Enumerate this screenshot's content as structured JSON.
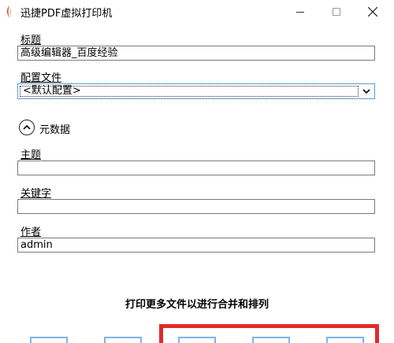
{
  "window": {
    "title": "迅捷PDF虚拟打印机",
    "controls": [
      "minimize",
      "maximize",
      "close"
    ]
  },
  "fields": {
    "title_label": "标题",
    "title_value": "高级编辑器_百度经验",
    "config_label": "配置文件",
    "config_value": "<默认配置>",
    "metadata_label": "元数据",
    "subject_label": "主题",
    "subject_value": "",
    "keywords_label": "关键字",
    "keywords_value": "",
    "author_label": "作者",
    "author_value": "admin"
  },
  "merge": {
    "text": "打印更多文件以进行合并和排列"
  },
  "icons": {
    "app": "pdf-printer-icon",
    "metadata_toggle": "chevron-up-circle-icon",
    "dropdown": "chevron-down-icon"
  },
  "colors": {
    "highlight": "#e12a2a",
    "focus_border": "#5b9bd5",
    "doc_button_border": "#7eb5e6"
  }
}
